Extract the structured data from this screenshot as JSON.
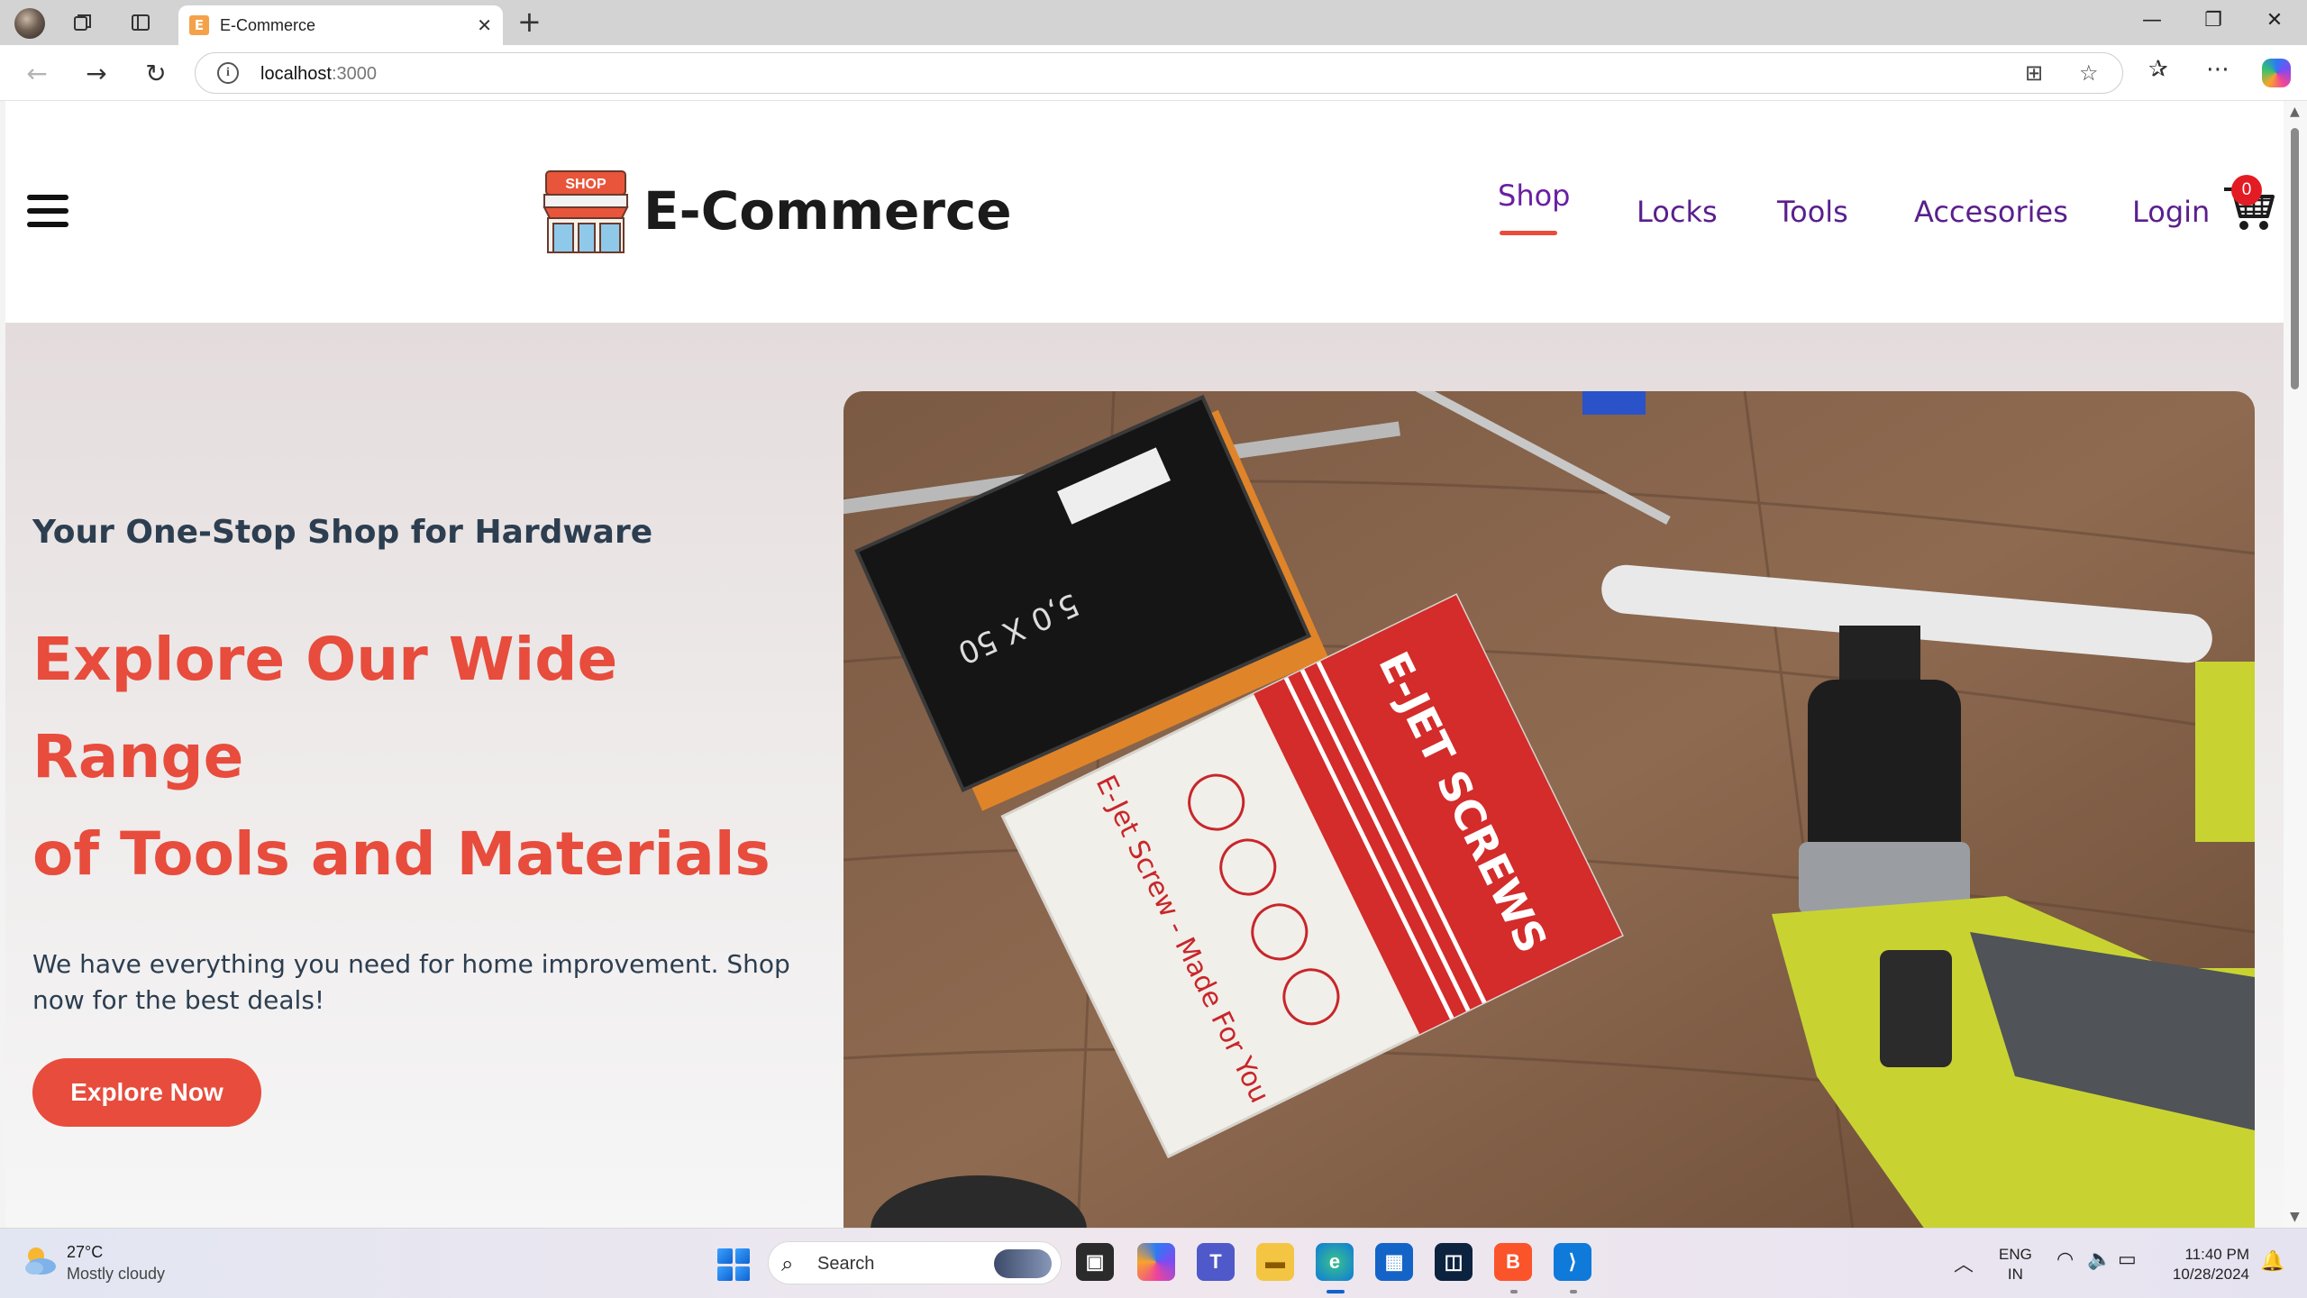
{
  "browser": {
    "tab_title": "E-Commerce",
    "tab_favicon_letter": "E",
    "url_host": "localhost",
    "url_port": ":3000"
  },
  "site": {
    "brand_name": "E-Commerce",
    "logo_sign_text": "SHOP",
    "nav": [
      {
        "label": "Shop",
        "active": true
      },
      {
        "label": "Locks",
        "active": false
      },
      {
        "label": "Tools",
        "active": false
      },
      {
        "label": "Accesories",
        "active": false
      },
      {
        "label": "Login",
        "active": false
      }
    ],
    "cart_count": "0"
  },
  "hero": {
    "eyebrow": "Your One-Stop Shop for Hardware",
    "title_line1": "Explore Our Wide Range",
    "title_line2": "of Tools and Materials",
    "subtitle": "We have everything you need for home improvement. Shop now for the best deals!",
    "cta_label": "Explore Now",
    "image_box_text": "E-JET SCREWS",
    "image_box_side_text": "E-Jet Screw - Made For You"
  },
  "taskbar": {
    "weather_temp": "27°C",
    "weather_desc": "Mostly cloudy",
    "search_placeholder": "Search",
    "lang_line1": "ENG",
    "lang_line2": "IN",
    "time": "11:40 PM",
    "date": "10/28/2024"
  },
  "colors": {
    "accent": "#e74c3c",
    "nav_text": "#5a1f8c",
    "heading_dark": "#2c3e50",
    "badge_red": "#e31b23"
  }
}
